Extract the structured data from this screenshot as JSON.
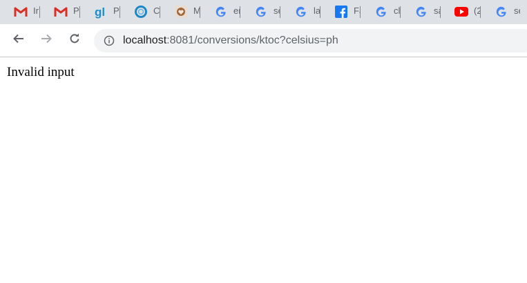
{
  "tabs": [
    {
      "icon": "gmail-icon",
      "title": "Ir"
    },
    {
      "icon": "gmail-icon",
      "title": "P"
    },
    {
      "icon": "gl-icon",
      "title": "P"
    },
    {
      "icon": "circle-logo-icon",
      "title": "C"
    },
    {
      "icon": "heart-shield-icon",
      "title": "M"
    },
    {
      "icon": "google-icon",
      "title": "er"
    },
    {
      "icon": "google-icon",
      "title": "se"
    },
    {
      "icon": "google-icon",
      "title": "la"
    },
    {
      "icon": "facebook-icon",
      "title": "Fa"
    },
    {
      "icon": "google-icon",
      "title": "cl"
    },
    {
      "icon": "google-icon",
      "title": "sa"
    },
    {
      "icon": "youtube-icon",
      "title": "(2"
    },
    {
      "icon": "google-icon",
      "title": "se"
    }
  ],
  "toolbar": {
    "back_icon": "arrow-left-icon",
    "forward_icon": "arrow-right-icon",
    "reload_icon": "reload-icon"
  },
  "address": {
    "host": "localhost",
    "path": ":8081/conversions/ktoc?celsius=ph",
    "info_icon": "info-icon"
  },
  "page": {
    "message": "Invalid input"
  },
  "colors": {
    "tabstrip": "#dee1e6",
    "omnibox": "#f1f3f4",
    "gmail_red": "#d93025",
    "facebook_blue": "#1877f2",
    "youtube_red": "#ff0000"
  }
}
